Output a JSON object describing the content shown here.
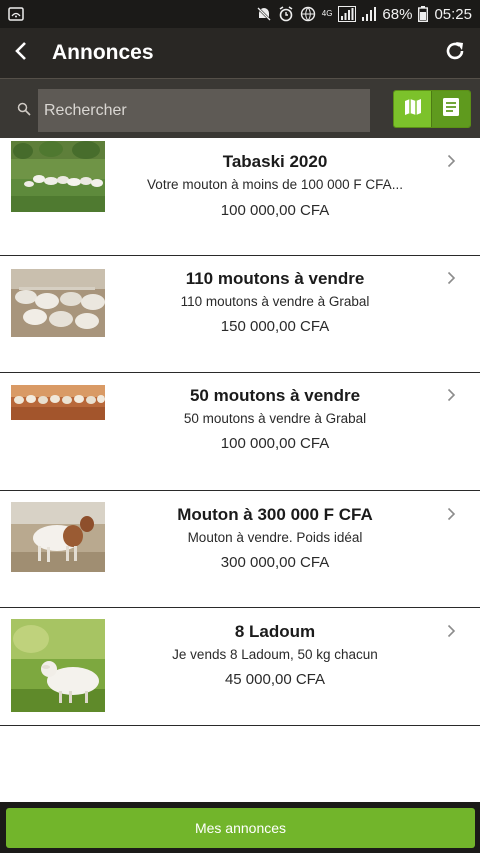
{
  "status_bar": {
    "network": "4G",
    "battery": "68%",
    "time": "05:25"
  },
  "header": {
    "title": "Annonces"
  },
  "search": {
    "placeholder": "Rechercher"
  },
  "listings": [
    {
      "title": "Tabaski 2020",
      "description": "Votre mouton à moins de 100 000 F CFA...",
      "price": "100 000,00 CFA"
    },
    {
      "title": "110 moutons à vendre",
      "description": "110 moutons à vendre à Grabal",
      "price": "150 000,00 CFA"
    },
    {
      "title": "50 moutons à vendre",
      "description": "50 moutons à vendre à Grabal",
      "price": "100 000,00 CFA"
    },
    {
      "title": "Mouton à 300 000 F CFA",
      "description": "Mouton à vendre. Poids idéal",
      "price": "300 000,00 CFA"
    },
    {
      "title": "8 Ladoum",
      "description": "Je vends 8 Ladoum, 50 kg chacun",
      "price": "45 000,00 CFA"
    }
  ],
  "footer": {
    "button_label": "Mes annonces"
  },
  "colors": {
    "accent": "#72b52b",
    "header": "#292724",
    "status_bar": "#1b1a18"
  }
}
